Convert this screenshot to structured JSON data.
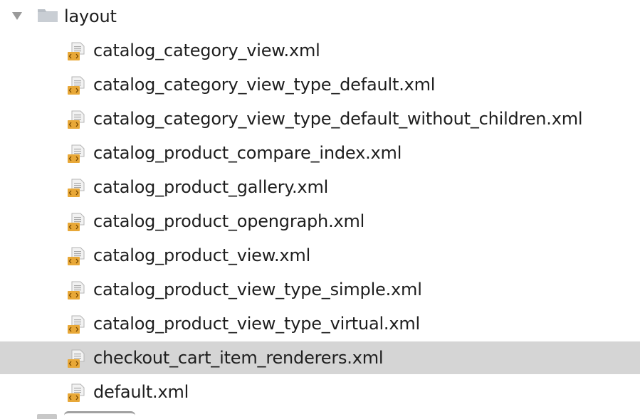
{
  "tree": {
    "folder": {
      "name": "layout",
      "icon": "folder-icon",
      "expanded": true,
      "children": [
        {
          "name": "catalog_category_view.xml",
          "icon": "xml-file-icon"
        },
        {
          "name": "catalog_category_view_type_default.xml",
          "icon": "xml-file-icon"
        },
        {
          "name": "catalog_category_view_type_default_without_children.xml",
          "icon": "xml-file-icon"
        },
        {
          "name": "catalog_product_compare_index.xml",
          "icon": "xml-file-icon"
        },
        {
          "name": "catalog_product_gallery.xml",
          "icon": "xml-file-icon"
        },
        {
          "name": "catalog_product_opengraph.xml",
          "icon": "xml-file-icon"
        },
        {
          "name": "catalog_product_view.xml",
          "icon": "xml-file-icon"
        },
        {
          "name": "catalog_product_view_type_simple.xml",
          "icon": "xml-file-icon"
        },
        {
          "name": "catalog_product_view_type_virtual.xml",
          "icon": "xml-file-icon"
        },
        {
          "name": "checkout_cart_item_renderers.xml",
          "icon": "xml-file-icon",
          "selected": true
        },
        {
          "name": "default.xml",
          "icon": "xml-file-icon"
        }
      ]
    }
  },
  "colors": {
    "selection": "#d5d5d5",
    "folder": "#b9bfc6",
    "file_paper": "#f2f2f2",
    "file_badge": "#e8a838",
    "text": "#1e1e1e"
  }
}
